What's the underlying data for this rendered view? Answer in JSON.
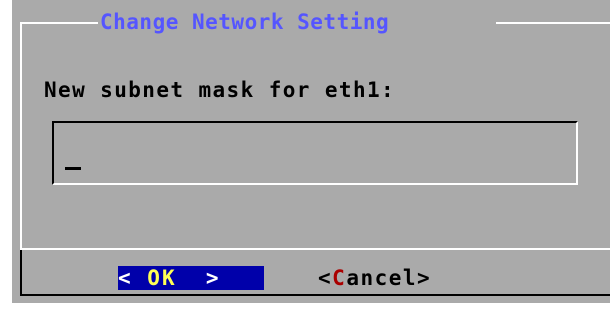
{
  "dialog": {
    "title": "Change Network Setting",
    "prompt": "New subnet mask for eth1:",
    "input": {
      "value": ""
    }
  },
  "buttons": {
    "ok": {
      "left": "< ",
      "hotkey": "OK",
      "right": "  >"
    },
    "cancel": {
      "left": "<",
      "hotkey": "C",
      "right": "ancel>"
    }
  },
  "colors": {
    "dialog_bg": "#aaaaaa",
    "title": "#5555ff",
    "button_focus_bg": "#0000aa",
    "hotkey_focus": "#ffff55",
    "hotkey_normal": "#aa0000"
  }
}
